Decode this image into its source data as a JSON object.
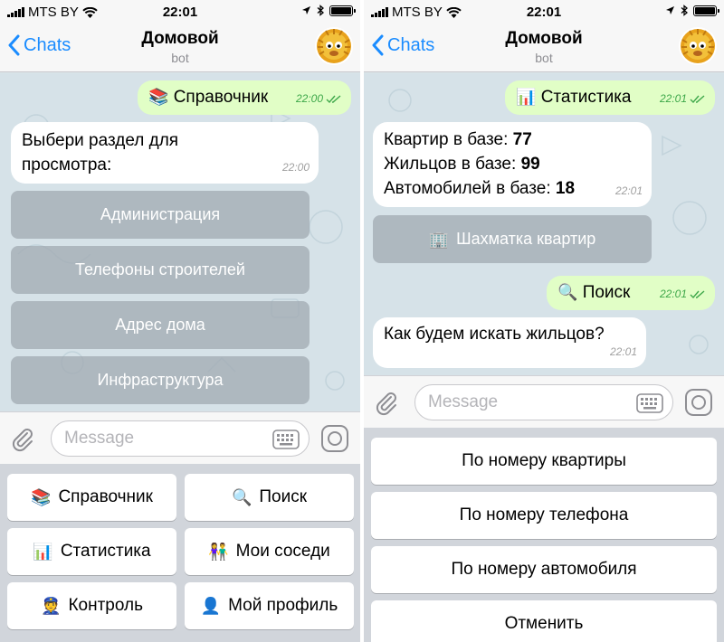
{
  "status_bar": {
    "carrier": "MTS BY",
    "time": "22:01"
  },
  "left": {
    "nav": {
      "back_label": "Chats",
      "title": "Домовой",
      "subtitle": "bot"
    },
    "messages": {
      "out1": {
        "emoji": "📚",
        "text": "Справочник",
        "time": "22:00"
      },
      "in1": {
        "text": "Выбери раздел для просмотра:",
        "time": "22:00"
      }
    },
    "inline_buttons": [
      {
        "label": "Администрация"
      },
      {
        "label": "Телефоны строителей"
      },
      {
        "label": "Адрес дома"
      },
      {
        "label": "Инфраструктура"
      }
    ],
    "input": {
      "placeholder": "Message"
    },
    "keyboard": [
      {
        "emoji": "📚",
        "label": "Справочник"
      },
      {
        "emoji": "🔍",
        "label": "Поиск"
      },
      {
        "emoji": "📊",
        "label": "Статистика"
      },
      {
        "emoji": "👫",
        "label": "Мои соседи"
      },
      {
        "emoji": "👮",
        "label": "Контроль"
      },
      {
        "emoji": "👤",
        "label": "Мой профиль"
      }
    ]
  },
  "right": {
    "nav": {
      "back_label": "Chats",
      "title": "Домовой",
      "subtitle": "bot"
    },
    "messages": {
      "out1": {
        "emoji": "📊",
        "text": "Статистика",
        "time": "22:01"
      },
      "stats": {
        "line1_label": "Квартир в базе:",
        "line1_value": "77",
        "line2_label": "Жильцов в базе:",
        "line2_value": "99",
        "line3_label": "Автомобилей в базе:",
        "line3_value": "18",
        "time": "22:01"
      },
      "out2": {
        "emoji": "🔍",
        "text": "Поиск",
        "time": "22:01"
      },
      "in2": {
        "text": "Как будем искать жильцов?",
        "time": "22:01"
      }
    },
    "inline_buttons": [
      {
        "emoji": "🏢",
        "label": "Шахматка квартир"
      }
    ],
    "input": {
      "placeholder": "Message"
    },
    "keyboard": [
      {
        "label": "По номеру квартиры"
      },
      {
        "label": "По номеру телефона"
      },
      {
        "label": "По номеру автомобиля"
      },
      {
        "label": "Отменить"
      }
    ]
  },
  "colors": {
    "accent": "#1a8cff",
    "out_bubble": "#e1fec6",
    "in_bubble": "#ffffff",
    "out_time": "#3ea84a",
    "chat_bg": "#d6e2e8"
  }
}
